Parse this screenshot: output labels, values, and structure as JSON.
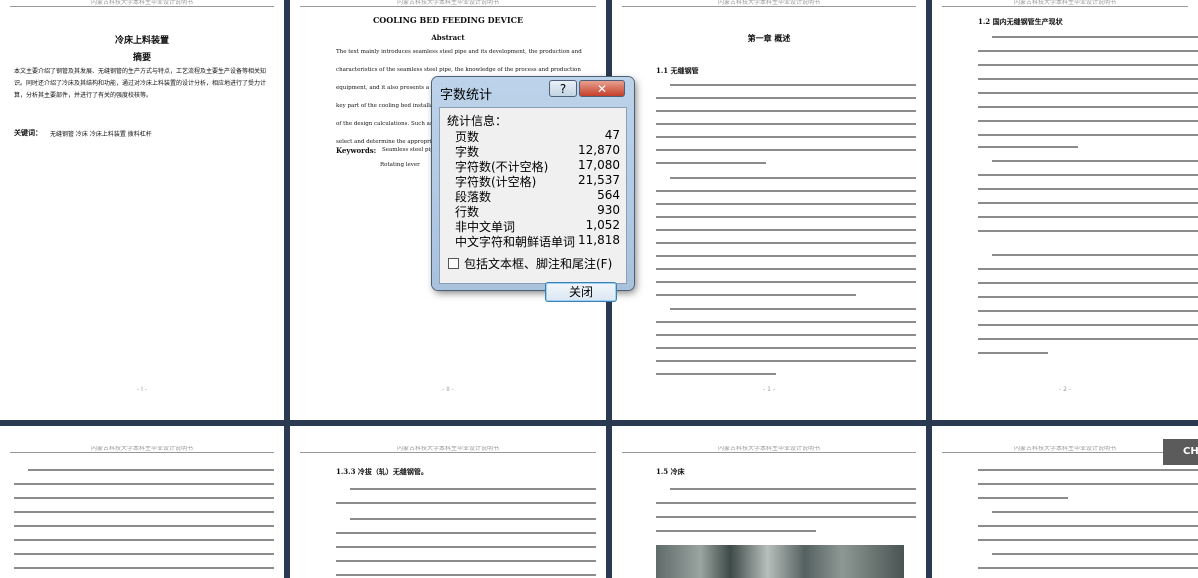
{
  "pages": {
    "header_text": "内蒙古科技大学本科生毕业设计说明书",
    "p1": {
      "title": "冷床上料装置",
      "abstract_heading": "摘要",
      "body": "本文主要介绍了钢管及其发展、无缝钢管的生产方式与特点，工艺流程及主要生产设备等相关知识。同时还介绍了冷床及其结构和功能，通过对冷床上料装置的设计分析，相应地进行了受力计算，分析其主要部件，并进行了有关的强度校核等。",
      "keywords_label": "关键词：",
      "keywords": "无缝钢管    冷床    冷床上料装置    拨料杠杆",
      "page_no": "- I -"
    },
    "p2": {
      "title": "COOLING BED FEEDING DEVICE",
      "abstract_heading": "Abstract",
      "lines": [
        "The text mainly introduces seamless steel pipe and its development, the production and",
        "characteristics of the seamless steel pipe, the knowledge of the process and production",
        "equipment, and it also presents a cooling bed and its structure and function. The",
        "key part of the cooling bed installation design",
        "of the design calculations. Such as",
        "select and determine the appropriate"
      ],
      "keywords_label": "Keywords:",
      "keywords": "Seamless steel pipe    cooling bed",
      "keywords2": "Rotating lever",
      "page_no": "- II -"
    },
    "p3": {
      "chapter": "第一章    概述",
      "section": "1.1 无缝钢管",
      "page_no": "- 1 -"
    },
    "p4": {
      "section": "1.2 国内无缝钢管生产现状",
      "page_no": "- 2 -"
    },
    "p6": {
      "section": "1.3.3 冷拔（轧）无缝钢管。"
    },
    "p7": {
      "section": "1.5 冷床"
    }
  },
  "dialog": {
    "title": "字数统计",
    "help_label": "?",
    "close_label": "✕",
    "group_label": "统计信息：",
    "stats": [
      {
        "label": "页数",
        "value": "47"
      },
      {
        "label": "字数",
        "value": "12,870"
      },
      {
        "label": "字符数(不计空格)",
        "value": "17,080"
      },
      {
        "label": "字符数(计空格)",
        "value": "21,537"
      },
      {
        "label": "段落数",
        "value": "564"
      },
      {
        "label": "行数",
        "value": "930"
      },
      {
        "label": "非中文单词",
        "value": "1,052"
      },
      {
        "label": "中文字符和朝鲜语单词",
        "value": "11,818"
      }
    ],
    "checkbox_label": "包括文本框、脚注和尾注(F)",
    "ok_label": "关闭"
  },
  "side_button": {
    "label": "CH"
  }
}
